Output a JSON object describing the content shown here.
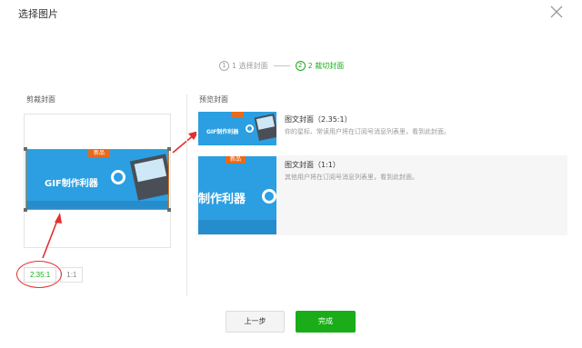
{
  "dialog": {
    "title": "选择图片",
    "close_icon": "close-icon"
  },
  "steps": [
    {
      "num": "1",
      "label": "1 选择封面",
      "active": false
    },
    {
      "num": "2",
      "label": "2 裁切封面",
      "active": true
    }
  ],
  "crop": {
    "title": "剪裁封面",
    "banner_text": "GIF制作利器",
    "tag_text": "新品",
    "ratios": [
      {
        "label": "2.35:1",
        "active": true
      },
      {
        "label": "1:1",
        "active": false
      }
    ]
  },
  "preview": {
    "title": "预览封面",
    "items": [
      {
        "title": "图文封面（2.35:1）",
        "desc": "你的星标、常读用户将在订阅号消息列表里，看到此封面。"
      },
      {
        "title": "图文封面（1:1）",
        "desc": "其他用户将在订阅号消息列表里，看到此封面。"
      }
    ],
    "thumb2_text": "制作利器"
  },
  "footer": {
    "prev_label": "上一步",
    "done_label": "完成"
  },
  "colors": {
    "accent": "#1aad19",
    "banner_blue": "#2b9fe1",
    "tag_orange": "#e86a1b",
    "annotation_red": "#e62e2e"
  }
}
